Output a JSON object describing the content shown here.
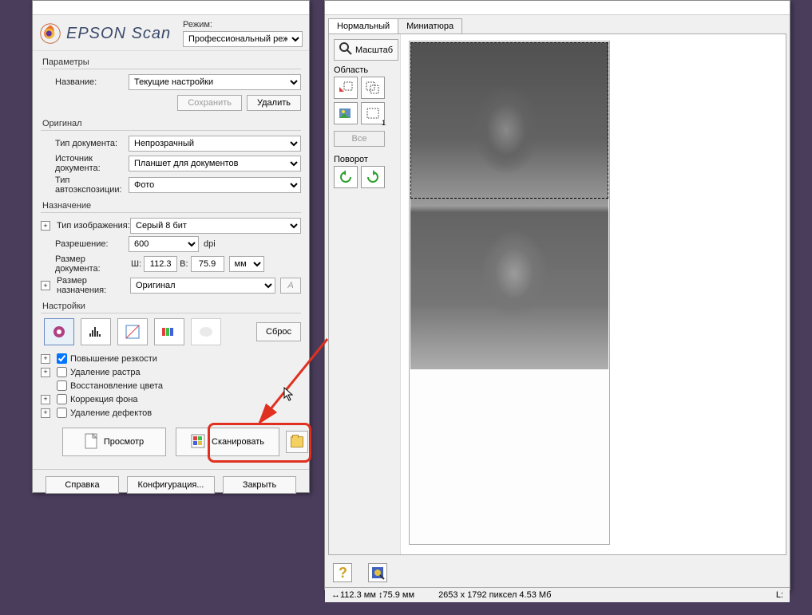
{
  "main": {
    "brand": "EPSON Scan",
    "mode_label": "Режим:",
    "mode_value": "Профессиональный режим",
    "params_title": "Параметры",
    "name_label": "Название:",
    "name_value": "Текущие настройки",
    "save_btn": "Сохранить",
    "delete_btn": "Удалить",
    "original_title": "Оригинал",
    "doc_type_label": "Тип документа:",
    "doc_type_value": "Непрозрачный",
    "doc_source_label": "Источник документа:",
    "doc_source_value": "Планшет для документов",
    "auto_exposure_label": "Тип автоэкспозиции:",
    "auto_exposure_value": "Фото",
    "destination_title": "Назначение",
    "image_type_label": "Тип изображения:",
    "image_type_value": "Серый 8 бит",
    "resolution_label": "Разрешение:",
    "resolution_value": "600",
    "resolution_unit": "dpi",
    "doc_size_label": "Размер документа:",
    "w_label": "Ш:",
    "w_value": "112.3",
    "h_label": "В:",
    "h_value": "75.9",
    "unit_value": "мм",
    "target_size_label": "Размер назначения:",
    "target_size_value": "Оригинал",
    "settings_title": "Настройки",
    "reset_btn": "Сброс",
    "sharpen_label": "Повышение резкости",
    "descreening_label": "Удаление растра",
    "color_restore_label": "Восстановление цвета",
    "backlight_label": "Коррекция фона",
    "dust_label": "Удаление дефектов",
    "preview_btn": "Просмотр",
    "scan_btn": "Сканировать",
    "help_btn": "Справка",
    "config_btn": "Конфигурация...",
    "close_btn": "Закрыть"
  },
  "preview": {
    "tab_normal": "Нормальный",
    "tab_thumb": "Миниатюра",
    "zoom_btn": "Масштаб",
    "area_label": "Область",
    "count": "1",
    "all_btn": "Все",
    "rotate_label": "Поворот",
    "status_dim": "112.3 мм",
    "status_dim2": "75.9 мм",
    "status_px": "2653 x 1792 пиксел 4.53 Мб",
    "status_l": "L:"
  }
}
